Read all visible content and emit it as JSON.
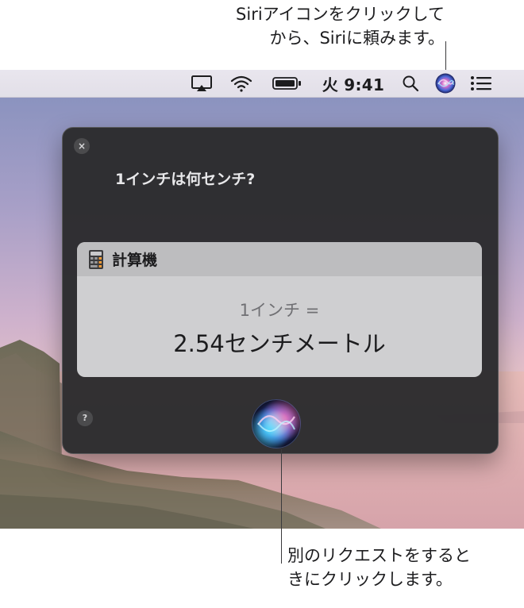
{
  "callouts": {
    "top": [
      "Siriアイコンをクリックして",
      "から、Siriに頼みます。"
    ],
    "bottom": [
      "別のリクエストをすると",
      "きにクリックします。"
    ]
  },
  "menubar": {
    "icons": [
      "airplay-icon",
      "wifi-icon",
      "battery-icon",
      "spotlight-icon",
      "siri-icon",
      "notification-center-icon"
    ],
    "clock": "火 9:41"
  },
  "siri_panel": {
    "query": "1インチは何センチ?",
    "card": {
      "title": "計算機",
      "icon": "calculator-icon",
      "expression": "1インチ =",
      "result": "2.54センチメートル"
    },
    "buttons": {
      "close": "×",
      "help": "?"
    }
  },
  "colors": {
    "panel_bg": "#2b2b2d",
    "card_bg": "#cfcfd1",
    "card_header_bg": "#bdbdbf",
    "menubar_bg": "#e6e3eb"
  }
}
